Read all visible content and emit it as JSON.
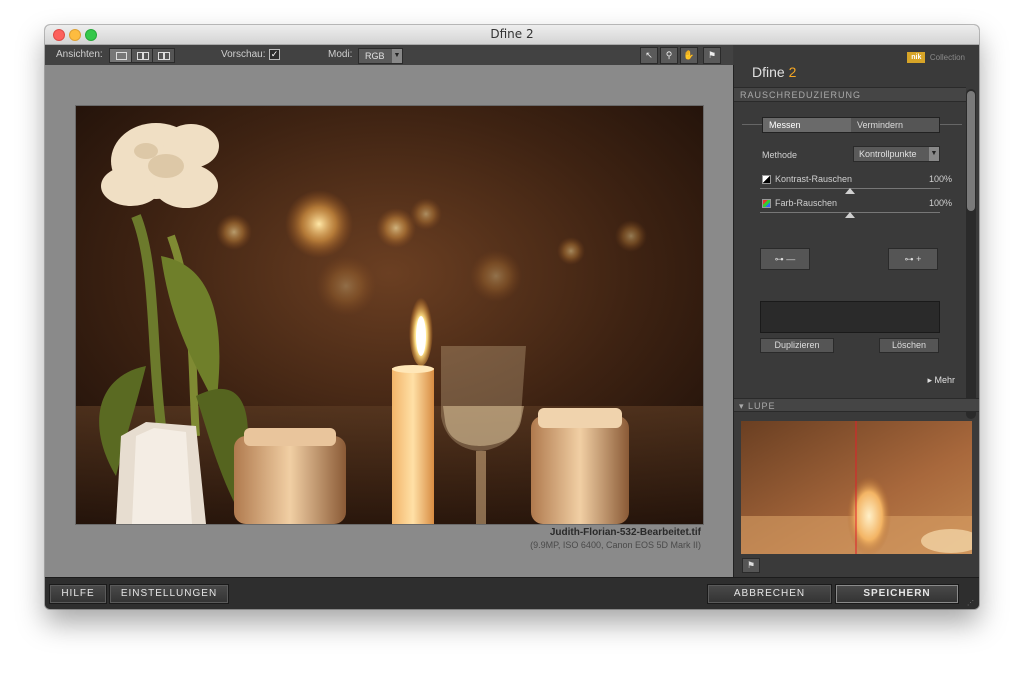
{
  "window": {
    "title": "Dfine 2"
  },
  "toolbar": {
    "views_label": "Ansichten:",
    "preview_label": "Vorschau:",
    "preview_checked": true,
    "mode_label": "Modi:",
    "mode_value": "RGB",
    "tools": [
      "arrow-tool-icon",
      "zoom-tool-icon",
      "hand-tool-icon",
      "pin-tool-icon"
    ]
  },
  "image": {
    "filename": "Judith-Florian-532-Bearbeitet.tif",
    "meta": "(9.9MP, ISO 6400, Canon EOS 5D Mark II)"
  },
  "panel": {
    "brand_nik": "nik",
    "brand_collection": "Collection",
    "app_name": "Dfine",
    "app_version": "2",
    "section_title": "RAUSCHREDUZIERUNG",
    "tab_measure": "Messen",
    "tab_reduce": "Vermindern",
    "method_label": "Methode",
    "method_value": "Kontrollpunkte",
    "contrast_noise_label": "Kontrast-Rauschen",
    "contrast_noise_value": "100%",
    "color_noise_label": "Farb-Rauschen",
    "color_noise_value": "100%",
    "remove_cp_label": "—",
    "add_cp_label": "+",
    "duplicate_label": "Duplizieren",
    "delete_label": "Löschen",
    "more_label": "Mehr",
    "loupe_title": "LUPE"
  },
  "bottom": {
    "help": "HILFE",
    "settings": "EINSTELLUNGEN",
    "cancel": "ABBRECHEN",
    "save": "SPEICHERN"
  },
  "colors": {
    "accent": "#f5a623",
    "panel_bg": "#3a3a3a",
    "canvas_bg": "#8a8a8a"
  }
}
